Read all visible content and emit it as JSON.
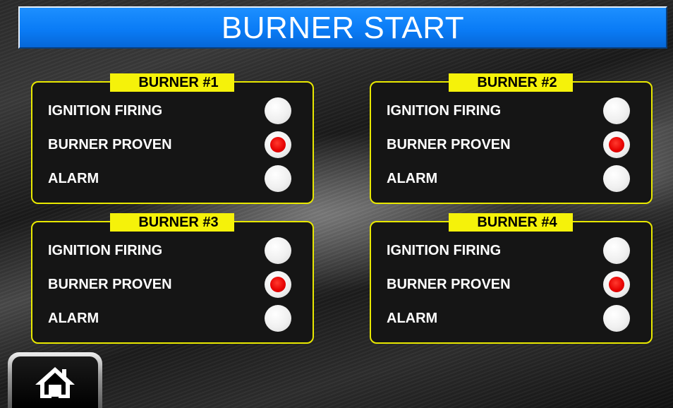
{
  "title": "BURNER START",
  "colors": {
    "title_bar": "#0a7cf6",
    "panel_border": "#e8e800",
    "panel_label_bg": "#f5f20a",
    "lamp_off": "#f0f0f0",
    "lamp_on": "#e60000"
  },
  "panels": [
    {
      "label": "BURNER #1",
      "rows": [
        {
          "label": "IGNITION FIRING",
          "active": false
        },
        {
          "label": "BURNER PROVEN",
          "active": true
        },
        {
          "label": "ALARM",
          "active": false
        }
      ]
    },
    {
      "label": "BURNER #2",
      "rows": [
        {
          "label": "IGNITION FIRING",
          "active": false
        },
        {
          "label": "BURNER PROVEN",
          "active": true
        },
        {
          "label": "ALARM",
          "active": false
        }
      ]
    },
    {
      "label": "BURNER #3",
      "rows": [
        {
          "label": "IGNITION FIRING",
          "active": false
        },
        {
          "label": "BURNER PROVEN",
          "active": true
        },
        {
          "label": "ALARM",
          "active": false
        }
      ]
    },
    {
      "label": "BURNER #4",
      "rows": [
        {
          "label": "IGNITION FIRING",
          "active": false
        },
        {
          "label": "BURNER PROVEN",
          "active": true
        },
        {
          "label": "ALARM",
          "active": false
        }
      ]
    }
  ],
  "home_button": {
    "icon": "home-icon"
  }
}
